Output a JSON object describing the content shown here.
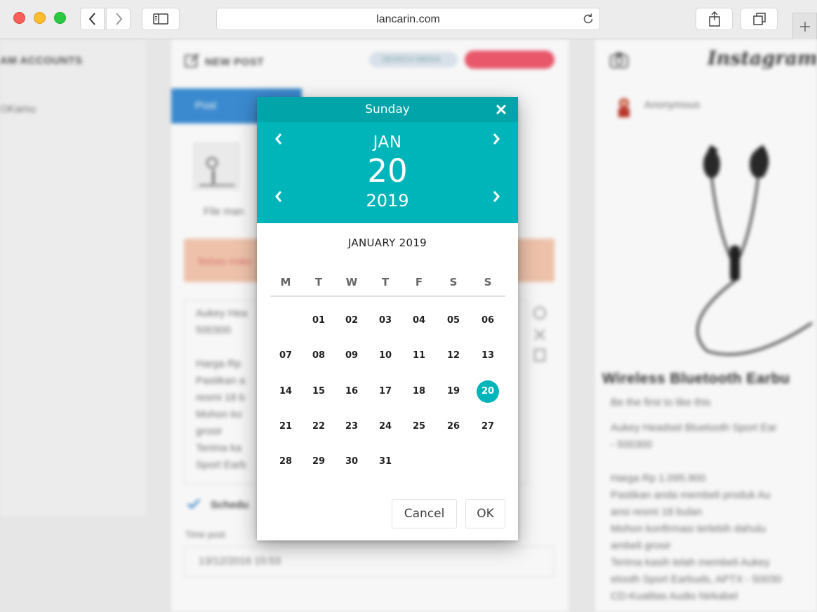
{
  "browser": {
    "url": "lancarin.com"
  },
  "background": {
    "accounts_heading": "AM ACCOUNTS",
    "account_name": "OKamu",
    "new_post_heading": "NEW POST",
    "search_media": "SEARCH MEDIA",
    "post_tab": "Post",
    "file_manager": "File man",
    "alert_text": "Bebas maks",
    "caption_lines": [
      "Aukey Hea",
      "500300",
      "",
      "Harga Rp",
      "Pastikan a",
      "resmi 18 b",
      "Mohon ko",
      "grosir",
      "Terima ka",
      "Sport Earb"
    ],
    "schedule_label": "Schedu",
    "time_post_label": "Time post",
    "time_post_value": "13/12/2016 15:53",
    "instagram_title": "Instagram",
    "anonymous": "Anonymous",
    "product_title": "Wireless Bluetooth Earbu",
    "likes_text": "Be the first to like this",
    "preview_lines": [
      "Aukey Headset Bluetooth Sport Ear",
      "- 500300",
      "",
      "Harga Rp 1.095.900",
      "Pastikan anda membeli produk Au",
      "ansi resmi 18 bulan",
      "Mohon konfirmasi terlebih dahulu",
      "ambeli grosir",
      "Terima kasih telah membeli Aukey",
      "etooth Sport Earbuds, APTX - 50030",
      "CD-Kualitas Audio Nirkabel"
    ]
  },
  "datepicker": {
    "day_name": "Sunday",
    "month_short": "JAN",
    "day": "20",
    "year": "2019",
    "calendar_title": "JANUARY 2019",
    "weekdays": [
      "M",
      "T",
      "W",
      "T",
      "F",
      "S",
      "S"
    ],
    "weeks": [
      [
        "",
        "01",
        "02",
        "03",
        "04",
        "05",
        "06"
      ],
      [
        "07",
        "08",
        "09",
        "10",
        "11",
        "12",
        "13"
      ],
      [
        "14",
        "15",
        "16",
        "17",
        "18",
        "19",
        "20"
      ],
      [
        "21",
        "22",
        "23",
        "24",
        "25",
        "26",
        "27"
      ],
      [
        "28",
        "29",
        "30",
        "31",
        "",
        "",
        ""
      ]
    ],
    "selected_day": "20",
    "cancel_label": "Cancel",
    "ok_label": "OK",
    "accent_color": "#00b5b9",
    "header_dark_color": "#00a4a9"
  }
}
